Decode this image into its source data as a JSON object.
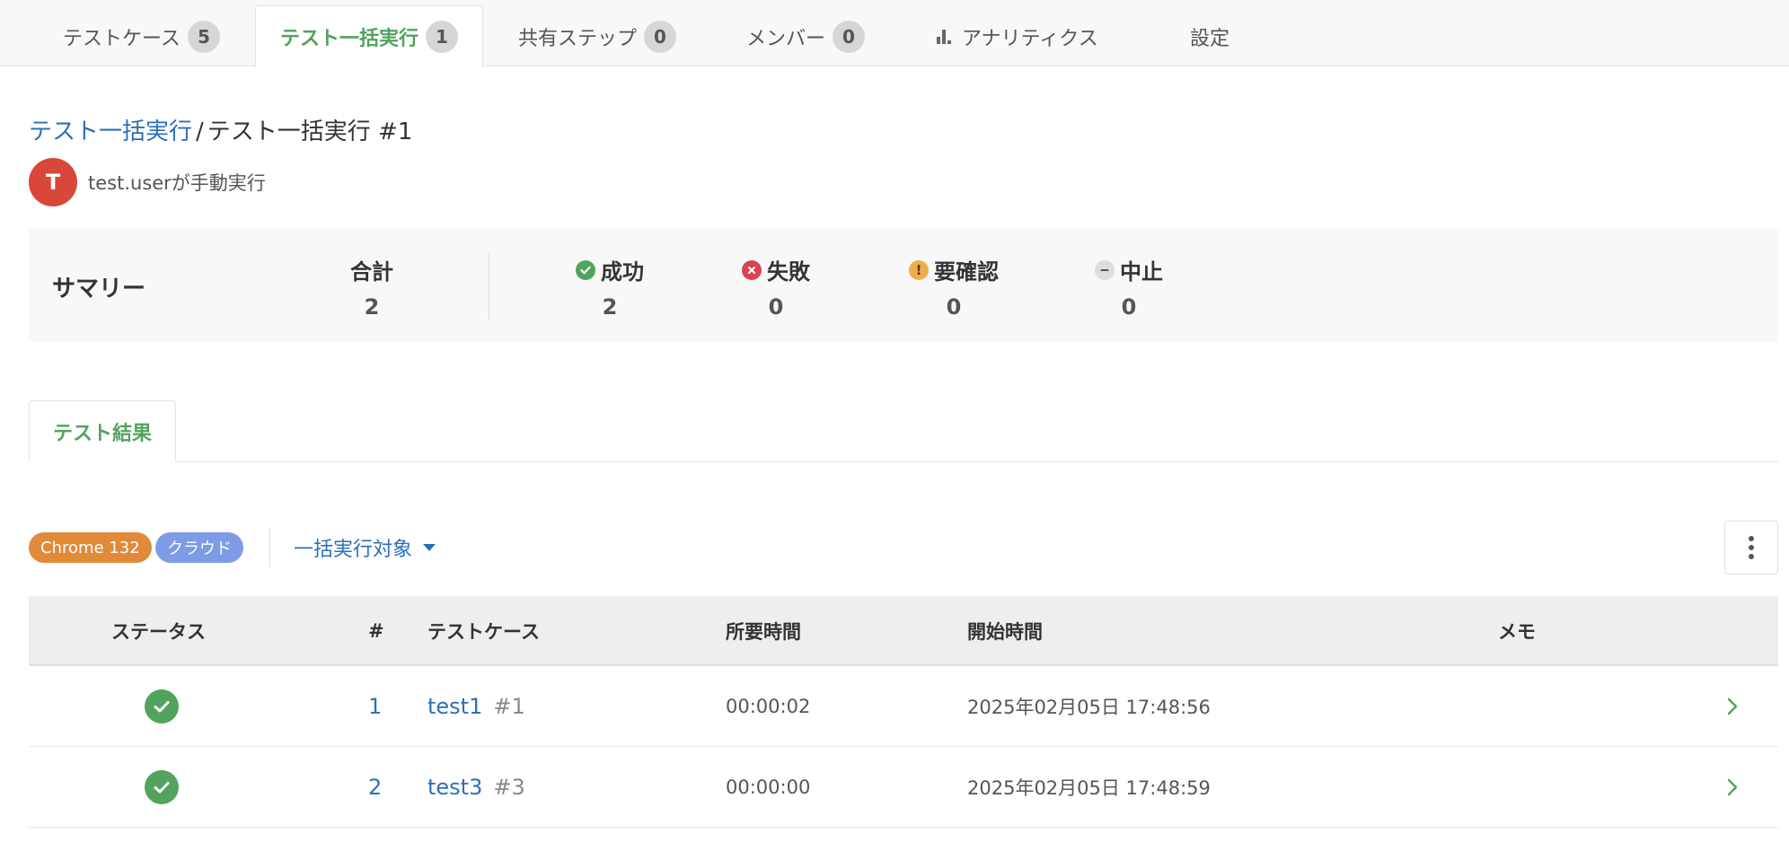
{
  "tabs": [
    {
      "label": "テストケース",
      "count": "5"
    },
    {
      "label": "テスト一括実行",
      "count": "1"
    },
    {
      "label": "共有ステップ",
      "count": "0"
    },
    {
      "label": "メンバー",
      "count": "0"
    },
    {
      "label": "アナリティクス"
    },
    {
      "label": "設定"
    }
  ],
  "breadcrumb": {
    "parent": "テスト一括実行",
    "separator": "/",
    "current": "テスト一括実行 #1"
  },
  "runner": {
    "avatar_letter": "T",
    "text": "test.userが手動実行"
  },
  "summary": {
    "title": "サマリー",
    "total": {
      "label": "合計",
      "value": "2"
    },
    "success": {
      "label": "成功",
      "value": "2"
    },
    "failed": {
      "label": "失敗",
      "value": "0"
    },
    "needs_review": {
      "label": "要確認",
      "value": "0"
    },
    "aborted": {
      "label": "中止",
      "value": "0"
    }
  },
  "result_tab": {
    "label": "テスト結果"
  },
  "filters": {
    "browser": "Chrome 132",
    "environment": "クラウド",
    "target_label": "一括実行対象"
  },
  "table": {
    "headers": {
      "status": "ステータス",
      "number": "#",
      "test_case": "テストケース",
      "duration": "所要時間",
      "start_time": "開始時間",
      "memo": "メモ"
    },
    "rows": [
      {
        "status": "success",
        "number": "1",
        "name": "test1",
        "case_id": "#1",
        "duration": "00:00:02",
        "start_time": "2025年02月05日 17:48:56",
        "memo": ""
      },
      {
        "status": "success",
        "number": "2",
        "name": "test3",
        "case_id": "#3",
        "duration": "00:00:00",
        "start_time": "2025年02月05日 17:48:59",
        "memo": ""
      }
    ]
  },
  "colors": {
    "accent_green": "#52a35e",
    "link_blue": "#2c6fbb",
    "failed_red": "#d94452",
    "warning_orange": "#f0ad4e",
    "chrome_badge": "#e08a3a",
    "cloud_badge": "#7d9be6"
  },
  "icons": {
    "success": "check-circle-icon",
    "failed": "x-circle-icon",
    "needs_review": "exclamation-circle-icon",
    "aborted": "minus-circle-icon",
    "analytics": "bar-chart-icon",
    "menu": "kebab-menu-icon",
    "row_open": "chevron-right-icon"
  }
}
